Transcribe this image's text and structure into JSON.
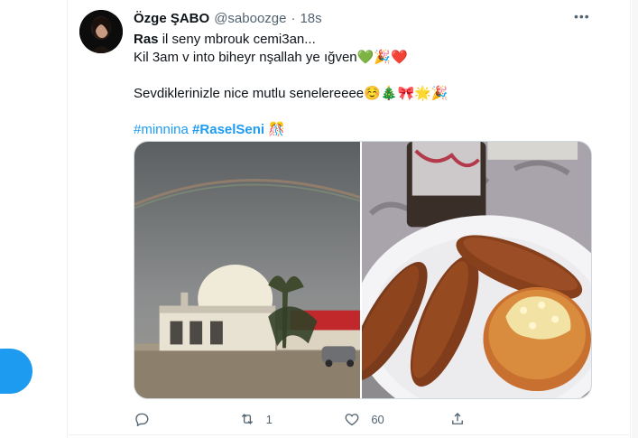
{
  "tweet": {
    "author_name": "Özge ŞABO",
    "handle": "@saboozge",
    "separator": "·",
    "time": "18s",
    "more_label": "•••",
    "lines": {
      "line1_bold": "Ras",
      "line1_rest": " il seny mbrouk cemi3an...",
      "line2": "Kil 3am v into biheyr nşallah ye ığven💚🎉❤️",
      "line3": "Sevdiklerinizle nice mutlu senelereeee☺️🎄🎀🌟🎉"
    },
    "hashtags": [
      "#minnina",
      "#RaselSeni"
    ],
    "hashtag_emoji": "🎊",
    "actions": {
      "reply_count": "",
      "retweet_count": "1",
      "like_count": "60",
      "share_count": ""
    }
  },
  "colors": {
    "accent": "#1d9bf0",
    "text": "#0f1419",
    "muted": "#536471",
    "border": "#cfd9de"
  },
  "icons": [
    "reply-icon",
    "retweet-icon",
    "like-icon",
    "share-icon",
    "more-icon"
  ]
}
